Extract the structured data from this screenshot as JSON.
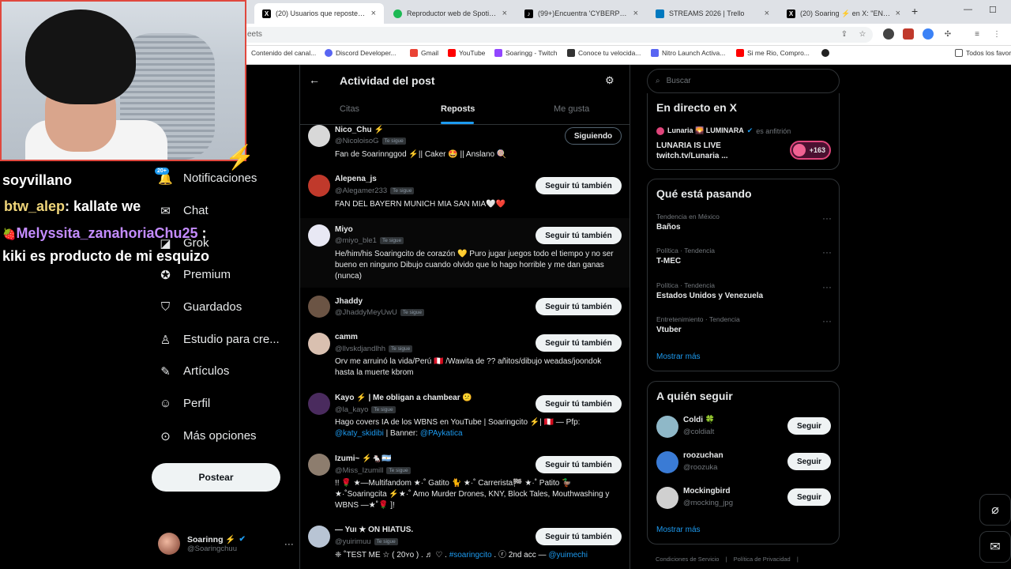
{
  "browser": {
    "tabs": [
      {
        "title": "(20) Usuarios que repostearon",
        "icon": "x-icon",
        "active": true
      },
      {
        "title": "Reproductor web de Spotify: m",
        "icon": "spotify-icon",
        "active": false
      },
      {
        "title": "(99+)Encuentra 'CYBERPUNK' e",
        "icon": "tiktok-icon",
        "active": false
      },
      {
        "title": "STREAMS 2026 | Trello",
        "icon": "trello-icon",
        "active": false
      },
      {
        "title": "(20) Soaring ⚡ en X: \"EN STR",
        "icon": "x-icon",
        "active": false
      }
    ],
    "new_tab": "+",
    "minimize": "—",
    "maximize": "☐",
    "url_fragment": "eets",
    "bookmarks": [
      {
        "label": "Contenido del canal...",
        "color": "#ff0000"
      },
      {
        "label": "Discord Developer...",
        "color": "#5865f2"
      },
      {
        "label": "Gmail",
        "color": "#ea4335"
      },
      {
        "label": "YouTube",
        "color": "#ff0000"
      },
      {
        "label": "Soaringg - Twitch",
        "color": "#9146ff"
      },
      {
        "label": "Conoce tu velocida...",
        "color": "#333333"
      },
      {
        "label": "Nitro Launch Activa...",
        "color": "#5865f2"
      },
      {
        "label": "Si me Rio, Compro...",
        "color": "#ff0000"
      }
    ],
    "all_bookmarks": "Todos los favor"
  },
  "chat": [
    {
      "user": "soyvillano",
      "message": "",
      "user_color": "#ffffff"
    },
    {
      "user": "btw_alep",
      "message": ": kallate we",
      "user_color": "#f0d67a"
    },
    {
      "user": "Melyssita_zanahoriaChu25",
      "message": " :",
      "user_color": "#c48cff"
    },
    {
      "user": "",
      "message": "kiki es producto de mi esquizo",
      "user_color": "#ffffff"
    }
  ],
  "nav": {
    "badge": "20+",
    "items": [
      {
        "label": "Notificaciones",
        "icon": "bell-icon"
      },
      {
        "label": "Chat",
        "icon": "mail-icon"
      },
      {
        "label": "Grok",
        "icon": "grok-icon"
      },
      {
        "label": "Premium",
        "icon": "verified-icon"
      },
      {
        "label": "Guardados",
        "icon": "bookmark-icon"
      },
      {
        "label": "Estudio para cre...",
        "icon": "studio-icon"
      },
      {
        "label": "Artículos",
        "icon": "article-icon"
      },
      {
        "label": "Perfil",
        "icon": "person-icon"
      },
      {
        "label": "Más opciones",
        "icon": "more-circle-icon"
      }
    ],
    "post_button": "Postear",
    "profile": {
      "name": "Soarinng ⚡",
      "handle": "@Soaringchuu"
    }
  },
  "center": {
    "title": "Actividad del post",
    "tabs": [
      "Citas",
      "Reposts",
      "Me gusta"
    ],
    "active_tab": "Reposts",
    "follows_you_label": "Te sigue",
    "rows": [
      {
        "name": "Nico_Chu ⚡",
        "handle": "@NicoloisoG",
        "follows_you": true,
        "bio": "Fan de Soarinnggod ⚡|| Caker 🤩 || Anslano 🍭",
        "button": "Siguiendo",
        "following": true,
        "avatar": "#d8d8d8"
      },
      {
        "name": "Alepena_js",
        "handle": "@Alegamer233",
        "follows_you": true,
        "bio": "FAN DEL BAYERN MUNICH MIA SAN MIA🤍❤️",
        "button": "Seguir tú también",
        "following": false,
        "avatar": "#c0392b"
      },
      {
        "name": "Miyo",
        "handle": "@miyo_ble1",
        "follows_you": true,
        "bio": "He/him/his Soaringcito de corazón 💛 Puro jugar juegos todo el tiempo y no ser bueno en ninguno Dibujo cuando olvido que lo hago horrible y me dan ganas (nunca)",
        "button": "Seguir tú también",
        "following": false,
        "avatar": "#e8e8f4"
      },
      {
        "name": "Jhaddy",
        "handle": "@JhaddyMeyUwU",
        "follows_you": true,
        "bio": "",
        "button": "Seguir tú también",
        "following": false,
        "avatar": "#6b5444"
      },
      {
        "name": "camm",
        "handle": "@llvskdjandlhh",
        "follows_you": true,
        "bio": "Orv me arruinó la vida/Perú 🇵🇪 /Wawita de ?? añitos/dibujo weadas/joondok hasta la muerte kbrom",
        "button": "Seguir tú también",
        "following": false,
        "avatar": "#d9c0b0"
      },
      {
        "name": "Kayo ⚡ | Me obligan a chambear 😕",
        "handle": "@la_kayo",
        "follows_you": true,
        "bio": "Hago covers IA de los WBNS en YouTube | Soaringcito ⚡| 🇵🇪 — Pfp:",
        "bio_line2_link1": "@katy_skidibi",
        "bio_line2_mid": " | Banner: ",
        "bio_line2_link2": "@PAykatica",
        "button": "Seguir tú también",
        "following": false,
        "avatar": "#4a2b5e"
      },
      {
        "name": "Izumi~ ⚡🐁🇦🇷",
        "handle": "@Miss_Izumill",
        "follows_you": true,
        "bio": "!! 🌹 ★—Multifandom ★·˚ Gatito 🐈 ★·˚ Carrerista🏁 ★·˚ Patito 🦆 ★·˚Soaringcita ⚡★·˚ Amo Murder Drones, KNY, Block Tales, Mouthwashing y WBNS —★˚🌹 ]!",
        "button": "Seguir tú también",
        "following": false,
        "avatar": "#8d7d6e"
      },
      {
        "name": "— Yuı ★ ON HIATUS.",
        "handle": "@yuirimuu",
        "follows_you": true,
        "bio_prefix": "❈ ˚TEST ME ☆ ( 20ʏo ) . ♬ ♡ . ",
        "bio_link1": "#soaringcito",
        "bio_mid": " . ⓡ 2nd acc — ",
        "bio_link2": "@yuimechi",
        "button": "Seguir tú también",
        "following": false,
        "avatar": "#b8c4d4"
      }
    ]
  },
  "right": {
    "search_placeholder": "Buscar",
    "live": {
      "title": "En directo en X",
      "host": "Lunaria 🌄 LUMINARA",
      "host_suffix": "es anfitrión",
      "text": "LUNARIA IS LIVE twitch.tv/Lunaria ...",
      "listeners": "+163"
    },
    "trends": {
      "title": "Qué está pasando",
      "items": [
        {
          "category": "Tendencia en México",
          "name": "Baños"
        },
        {
          "category": "Política · Tendencia",
          "name": "T-MEC"
        },
        {
          "category": "Política · Tendencia",
          "name": "Estados Unidos y Venezuela"
        },
        {
          "category": "Entretenimiento · Tendencia",
          "name": "Vtuber"
        }
      ],
      "show_more": "Mostrar más"
    },
    "follow": {
      "title": "A quién seguir",
      "items": [
        {
          "name": "Coldi 🍀",
          "handle": "@coldialt",
          "button": "Seguir",
          "avatar": "#8fb8c8"
        },
        {
          "name": "roozuchan",
          "handle": "@roozuka",
          "button": "Seguir",
          "avatar": "#3a7bd5"
        },
        {
          "name": "Mockingbird",
          "handle": "@mocking_jpg",
          "button": "Seguir",
          "avatar": "#d0d0d0"
        }
      ],
      "show_more": "Mostrar más"
    },
    "footer": [
      "Condiciones de Servicio",
      "|",
      "Política de Privacidad",
      "|"
    ]
  }
}
